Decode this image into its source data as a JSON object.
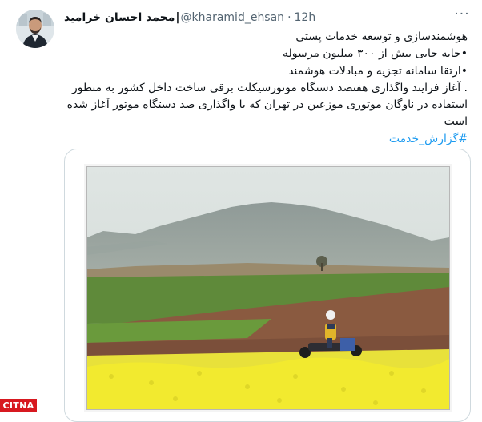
{
  "author": {
    "name": "محمد احسان خرامید",
    "separator": "|",
    "handle": "@kharamid_ehsan",
    "dot": "·",
    "time": "12h"
  },
  "more_glyph": "···",
  "tweet": {
    "lines": [
      "هوشمندسازی و توسعه خدمات پستی",
      "•جابه جایی بیش از ۳۰۰ میلیون مرسوله",
      "•ارتقا سامانه تجزیه و مبادلات هوشمند",
      ". آغاز فرایند واگذاری هفتصد دستگاه موتورسیکلت برقی ساخت داخل کشور به منظور استفاده در ناوگان موتوری موزعین در تهران که با واگذاری صد دستگاه موتور آغاز شده است"
    ],
    "hashtag": "#گزارش_خدمت"
  },
  "watermark": "CITNA",
  "colors": {
    "text": "#0f1419",
    "secondary": "#536471",
    "link": "#1d9bf0",
    "card_border": "#cfd9de",
    "watermark_bg": "#d71920"
  },
  "icons": [
    "avatar",
    "more-icon"
  ]
}
